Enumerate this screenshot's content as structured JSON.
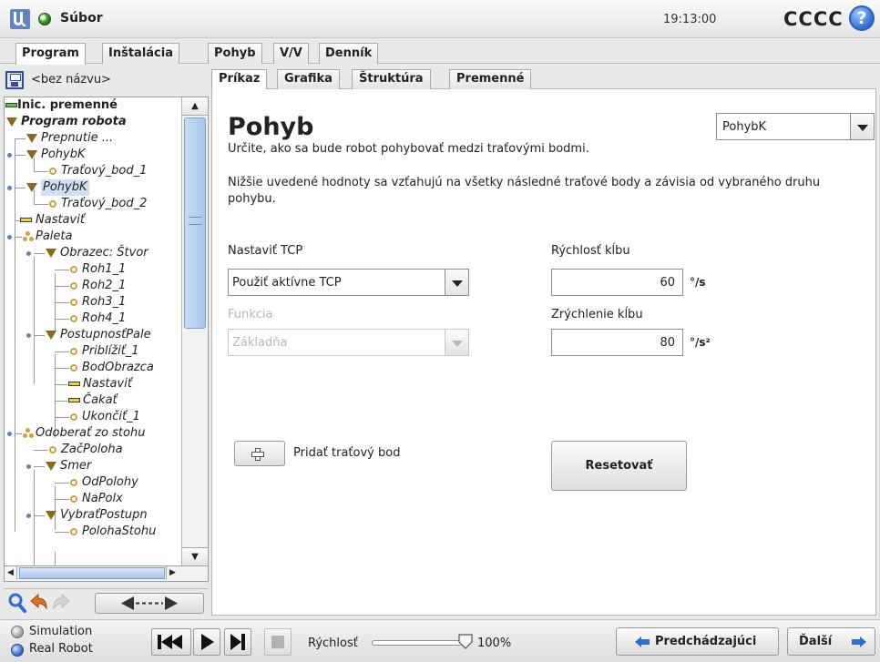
{
  "titlebar": {
    "file_menu": "Súbor",
    "clock": "19:13:00",
    "robot_name": "CCCC",
    "help": "?"
  },
  "main_tabs": [
    "Program",
    "Inštalácia",
    "Pohyb",
    "V/V",
    "Denník"
  ],
  "program": {
    "name": "<bez názvu>"
  },
  "tree": [
    "Inic. premenné",
    "Program robota",
    "Prepnutie ...",
    "PohybK",
    "Traťový_bod_1",
    "PohybK",
    "Traťový_bod_2",
    "Nastaviť",
    "Paleta",
    "Obrazec: Štvor",
    "Roh1_1",
    "Roh2_1",
    "Roh3_1",
    "Roh4_1",
    "PostupnosťPale",
    "Priblížiť_1",
    "BodObrazca",
    "Nastaviť",
    "Čakať",
    "Ukončiť_1",
    "Odoberať zo stohu",
    "ZačPoloha",
    "Smer",
    "OdPolohy",
    "NaPolx",
    "VybraťPostupn",
    "PolohaStohu"
  ],
  "sub_tabs": [
    "Príkaz",
    "Grafika",
    "Štruktúra",
    "Premenné"
  ],
  "move": {
    "title": "Pohyb",
    "type": "PohybK",
    "description": "Určite, ako sa bude robot pohybovať medzi traťovými bodmi.",
    "note": "Nižšie uvedené hodnoty sa vzťahujú na všetky následné traťové body a závisia od vybraného druhu pohybu.",
    "tcp_label": "Nastaviť TCP",
    "tcp_value": "Použiť aktívne TCP",
    "function_label": "Funkcia",
    "function_value": "Základňa",
    "joint_speed_label": "Rýchlosť kĺbu",
    "joint_speed_value": "60",
    "joint_speed_unit": "°/s",
    "joint_accel_label": "Zrýchlenie kĺbu",
    "joint_accel_value": "80",
    "joint_accel_unit": "°/s²",
    "add_waypoint_label": "Pridať traťový bod",
    "reset_label": "Resetovať"
  },
  "footer": {
    "simulation": "Simulation",
    "real_robot": "Real Robot",
    "speed_label": "Rýchlosť",
    "speed_value": "100%",
    "speed_fraction": 1.0,
    "prev_label": "Predchádzajúci",
    "next_label": "Ďalší"
  },
  "colors": {
    "accent_blue": "#2e6fd1",
    "status_green": "#4ab43a",
    "selection": "#cfe0f6"
  }
}
